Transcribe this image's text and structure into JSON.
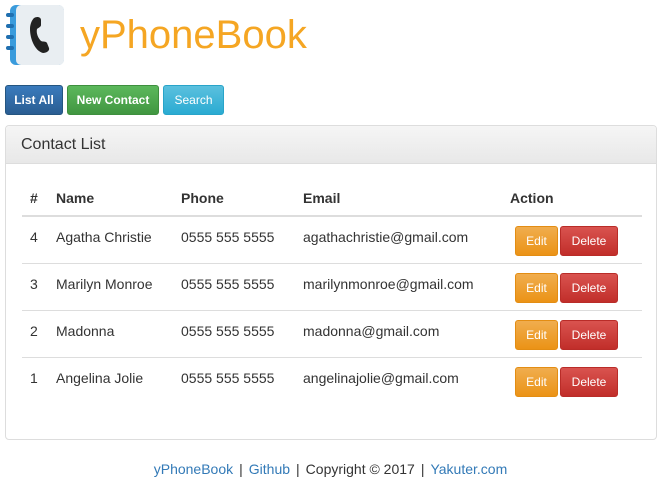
{
  "app": {
    "title": "yPhoneBook",
    "logo_icon": "phonebook-icon",
    "accent_color": "#f5a623"
  },
  "toolbar": {
    "list_all_label": "List All",
    "new_contact_label": "New Contact",
    "search_label": "Search"
  },
  "panel": {
    "heading": "Contact List"
  },
  "table": {
    "columns": [
      "#",
      "Name",
      "Phone",
      "Email",
      "Action"
    ],
    "rows": [
      {
        "id": "4",
        "name": "Agatha Christie",
        "phone": "0555 555 5555",
        "email": "agathachristie@gmail.com",
        "edit": "Edit",
        "delete": "Delete"
      },
      {
        "id": "3",
        "name": "Marilyn Monroe",
        "phone": "0555 555 5555",
        "email": "marilynmonroe@gmail.com",
        "edit": "Edit",
        "delete": "Delete"
      },
      {
        "id": "2",
        "name": "Madonna",
        "phone": "0555 555 5555",
        "email": "madonna@gmail.com",
        "edit": "Edit",
        "delete": "Delete"
      },
      {
        "id": "1",
        "name": "Angelina Jolie",
        "phone": "0555 555 5555",
        "email": "angelinajolie@gmail.com",
        "edit": "Edit",
        "delete": "Delete"
      }
    ]
  },
  "footer": {
    "link1": "yPhoneBook",
    "sep1": "|",
    "link2": "Github",
    "sep2": "|",
    "copyright": "Copyright © 2017",
    "sep3": "|",
    "link3": "Yakuter.com"
  }
}
